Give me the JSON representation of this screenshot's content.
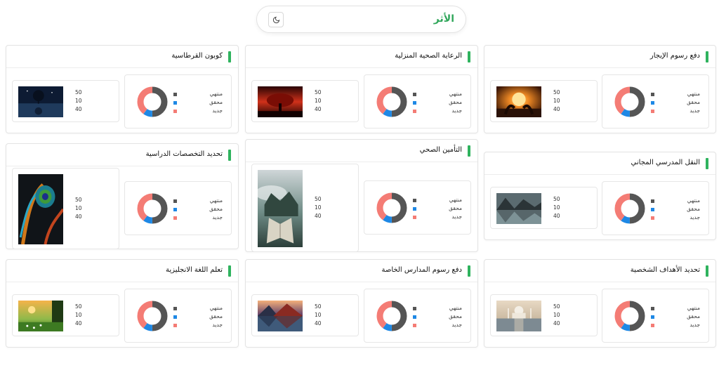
{
  "header": {
    "title": "الأثر",
    "theme_icon": "moon-icon"
  },
  "legend": [
    {
      "label": "منتهي",
      "color": "#555555"
    },
    {
      "label": "محقق",
      "color": "#1e88e5"
    },
    {
      "label": "جديد",
      "color": "#f47c75"
    }
  ],
  "cards": [
    {
      "title": "دفع رسوم الإيجار",
      "values": [
        "50",
        "10",
        "40"
      ],
      "donut": [
        50,
        10,
        40
      ],
      "image": "sunset-couple"
    },
    {
      "title": "الرعاية الصحية المنزلية",
      "values": [
        "50",
        "10",
        "40"
      ],
      "donut": [
        50,
        10,
        40
      ],
      "image": "red-tree"
    },
    {
      "title": "كوبون القرطاسية",
      "values": [
        "50",
        "10",
        "40"
      ],
      "donut": [
        50,
        10,
        40
      ],
      "image": "night-tree"
    },
    {
      "title": "النقل المدرسي المجاني",
      "values": [
        "50",
        "10",
        "40"
      ],
      "donut": [
        50,
        10,
        40
      ],
      "image": "mountain-lake"
    },
    {
      "title": "التأمين الصحي",
      "values": [
        "50",
        "10",
        "40"
      ],
      "donut": [
        50,
        10,
        40
      ],
      "image": "book-clouds"
    },
    {
      "title": "تحديد التخصصات الدراسية",
      "values": [
        "50",
        "10",
        "40"
      ],
      "donut": [
        50,
        10,
        40
      ],
      "image": "peacock-feather"
    },
    {
      "title": "تحديد الأهداف الشخصية",
      "values": [
        "50",
        "10",
        "40"
      ],
      "donut": [
        50,
        10,
        40
      ],
      "image": "taj-mahal"
    },
    {
      "title": "دفع رسوم المدارس الخاصة",
      "values": [
        "50",
        "10",
        "40"
      ],
      "donut": [
        50,
        10,
        40
      ],
      "image": "volcano-reflection"
    },
    {
      "title": "تعلم اللغة الانجليزية",
      "values": [
        "50",
        "10",
        "40"
      ],
      "donut": [
        50,
        10,
        40
      ],
      "image": "meadow-sunset"
    }
  ]
}
